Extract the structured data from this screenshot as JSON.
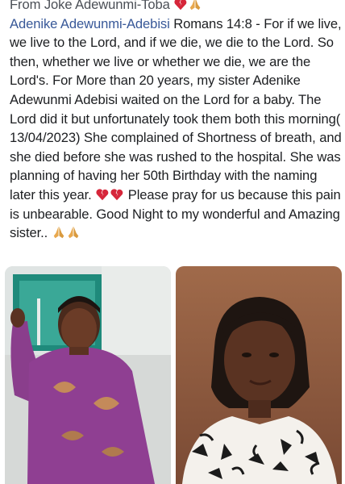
{
  "post": {
    "from_line": "From Joke Adewunmi-Toba",
    "author_name": "Adenike Adewunmi-Adebisi",
    "body_part1": " Romans 14:8 - For if we live, we live to the Lord, and if we die, we die to the Lord. So then, whether we live or whether we die, we are the Lord's.  For More than 20 years, my sister Adenike Adewunmi Adebisi waited on the Lord for a baby. The Lord did it but unfortunately took them both this morning( 13/04/2023) She complained of Shortness of breath, and she died before she was rushed to the hospital.   She was planning of having her 50th Birthday with the naming later this year. ",
    "body_part2": " Please pray for us because this  pain is unbearable. Good Night  to my wonderful and Amazing sister.. "
  },
  "icons": {
    "broken_heart": "broken-heart-emoji",
    "praying_hands": "praying-hands-emoji"
  },
  "photos": [
    {
      "name": "photo-woman-purple-dress"
    },
    {
      "name": "photo-woman-portrait"
    }
  ],
  "colors": {
    "link": "#385898",
    "text": "#1c1e21",
    "heart": "#d6263a",
    "hands": "#e8a84e"
  }
}
